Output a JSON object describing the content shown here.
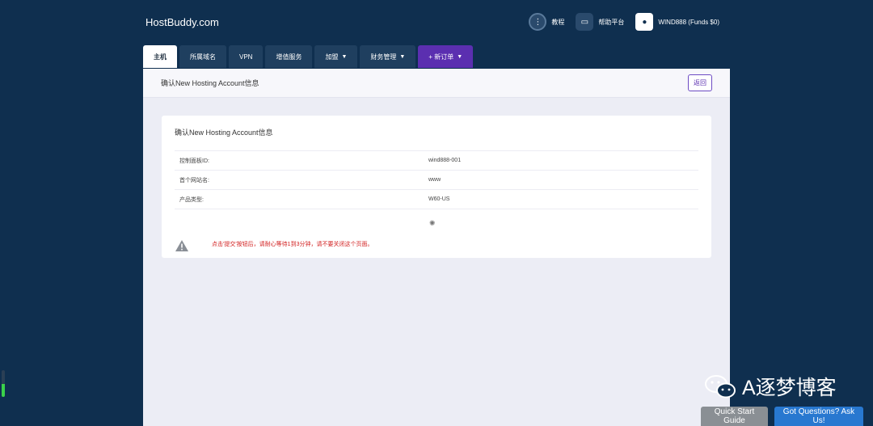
{
  "brand": "HostBuddy.com",
  "topbar": {
    "items": [
      {
        "label": "教程",
        "icon": "tutorial-icon"
      },
      {
        "label": "帮助平台",
        "icon": "chat-icon"
      },
      {
        "label": "WIND888 (Funds $0)",
        "icon": "user-icon"
      }
    ]
  },
  "tabs": [
    {
      "label": "主机"
    },
    {
      "label": "所属域名"
    },
    {
      "label": "VPN"
    },
    {
      "label": "增值服务"
    },
    {
      "label": "加盟"
    },
    {
      "label": "财务管理"
    },
    {
      "label": "+ 新订单"
    }
  ],
  "panel": {
    "title": "确认New Hosting Account信息",
    "back_label": "返回"
  },
  "card": {
    "title": "确认New Hosting Account信息",
    "rows": [
      {
        "label": "控制面板ID:",
        "value": "wind888-001"
      },
      {
        "label": "首个网站名:",
        "value": "www"
      },
      {
        "label": "产品类型:",
        "value": "W60-US"
      }
    ],
    "warning": "点击'提交'按钮后，请耐心等待1到3分钟，请不要关闭这个页面。"
  },
  "watermark": "A逐梦博客",
  "buttons": {
    "quick_start": "Quick Start Guide",
    "questions": "Got Questions? Ask Us!"
  },
  "colors": {
    "background": "#0f2f4f",
    "accent_purple": "#5b2fb0",
    "warning_red": "#d21f1f",
    "help_blue": "#2878d0"
  }
}
